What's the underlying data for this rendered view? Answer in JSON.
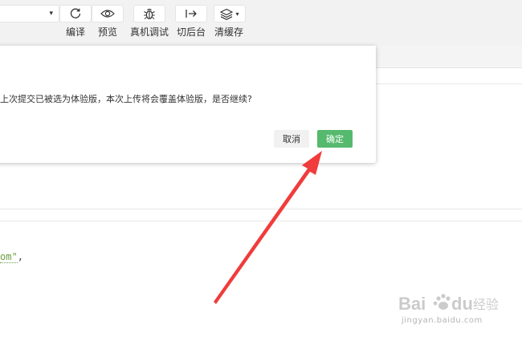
{
  "toolbar": {
    "buttons": [
      {
        "label": "编译",
        "icon": "refresh-icon"
      },
      {
        "label": "预览",
        "icon": "eye-icon"
      },
      {
        "label": "真机调试",
        "icon": "bug-icon"
      },
      {
        "label": "切后台",
        "icon": "switch-background-icon"
      },
      {
        "label": "清缓存",
        "icon": "layers-icon"
      }
    ],
    "dropdown_caret": "▾"
  },
  "editor": {
    "code_fragment_string": "om\"",
    "code_fragment_punct": ","
  },
  "dialog": {
    "message": "上次提交已被选为体验版，本次上传将会覆盖体验版，是否继续?",
    "cancel_label": "取消",
    "ok_label": "确定"
  },
  "colors": {
    "primary_green": "#55b96e",
    "annotation_arrow": "#f03c3c"
  },
  "watermark": {
    "logo_text": "Bai du 经验",
    "url": "jingyan.baidu.com"
  }
}
